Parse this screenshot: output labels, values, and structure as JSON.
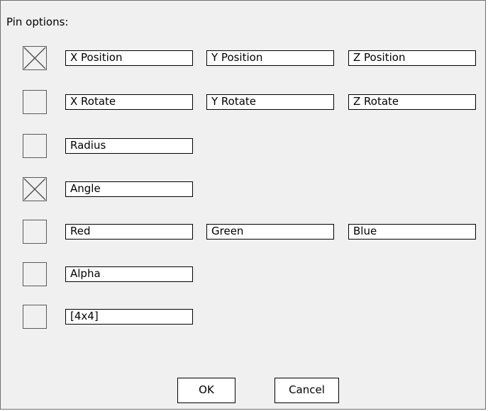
{
  "dialog": {
    "title": "Pin options:"
  },
  "rows": [
    {
      "checked": true,
      "fields": [
        "X Position",
        "Y Position",
        "Z Position"
      ]
    },
    {
      "checked": false,
      "fields": [
        "X Rotate",
        "Y Rotate",
        "Z Rotate"
      ]
    },
    {
      "checked": false,
      "fields": [
        "Radius"
      ]
    },
    {
      "checked": true,
      "fields": [
        "Angle"
      ]
    },
    {
      "checked": false,
      "fields": [
        "Red",
        "Green",
        "Blue"
      ]
    },
    {
      "checked": false,
      "fields": [
        "Alpha"
      ]
    },
    {
      "checked": false,
      "fields": [
        "[4x4]"
      ]
    }
  ],
  "buttons": {
    "ok_label": "OK",
    "cancel_label": "Cancel"
  },
  "colors": {
    "dialog_background": "#f0f0f0",
    "field_background": "#ffffff",
    "border": "#000000",
    "checkbox_border": "#5a5a5a"
  }
}
